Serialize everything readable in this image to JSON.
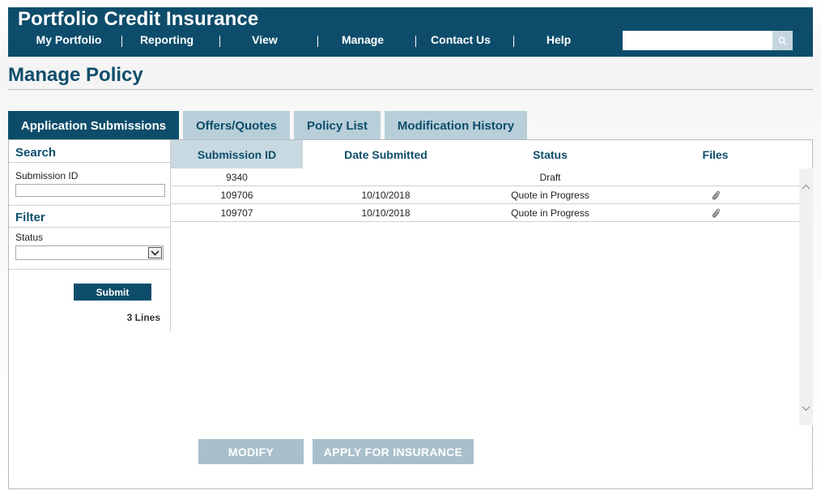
{
  "app": {
    "title": "Portfolio Credit Insurance"
  },
  "nav": [
    "My Portfolio",
    "Reporting",
    "View",
    "Manage",
    "Contact Us",
    "Help"
  ],
  "search": {
    "value": "",
    "icon": "search-icon"
  },
  "page": {
    "title": "Manage Policy"
  },
  "tabs": [
    {
      "label": "Application Submissions",
      "active": true
    },
    {
      "label": "Offers/Quotes",
      "active": false
    },
    {
      "label": "Policy List",
      "active": false
    },
    {
      "label": "Modification History",
      "active": false
    }
  ],
  "sidebar": {
    "search_heading": "Search",
    "submission_id_label": "Submission ID",
    "submission_id_value": "",
    "filter_heading": "Filter",
    "status_label": "Status",
    "status_value": "",
    "submit_label": "Submit",
    "lines_count": "3 Lines"
  },
  "table": {
    "columns": [
      "Submission ID",
      "Date Submitted",
      "Status",
      "Files"
    ],
    "sorted_column": "Submission ID",
    "rows": [
      {
        "id": "9340",
        "date": "",
        "status": "Draft",
        "has_file": false
      },
      {
        "id": "109706",
        "date": "10/10/2018",
        "status": "Quote in Progress",
        "has_file": true
      },
      {
        "id": "109707",
        "date": "10/10/2018",
        "status": "Quote in Progress",
        "has_file": true
      }
    ]
  },
  "actions": {
    "modify_label": "MODIFY",
    "apply_label": "APPLY FOR INSURANCE"
  },
  "colors": {
    "brand": "#0d4d6b",
    "tab_inactive": "#b8cfd9",
    "button_disabled": "#a9c0cc"
  }
}
